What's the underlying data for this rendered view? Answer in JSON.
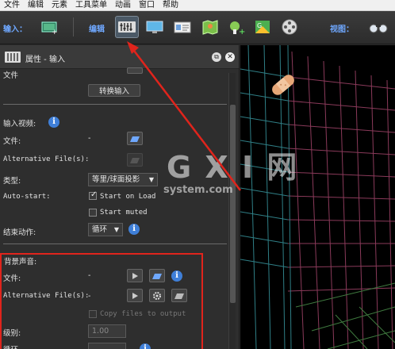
{
  "menu": {
    "items": [
      "文件",
      "编辑",
      "元素",
      "工具菜单",
      "动画",
      "窗口",
      "帮助"
    ]
  },
  "toolbar": {
    "input_label": "输入：",
    "edit_label": "编辑",
    "view_label": "视图："
  },
  "panel": {
    "title": "属性 - 输入",
    "top_label": "文件",
    "convert_button": "转换输入",
    "input_video_label": "输入视频:",
    "file_label": "文件:",
    "file_value": "-",
    "alt_files_label": "Alternative File(s):",
    "type_label": "类型:",
    "type_value": "等里/球面投影",
    "autostart_label": "Auto-start:",
    "start_on_load": "Start on Load",
    "start_muted": "Start muted",
    "end_action_label": "结束动作:",
    "end_action_value": "循环",
    "bg_sound_label": "背景声音:",
    "bg_file_label": "文件:",
    "bg_file_value": "-",
    "bg_alt_files_label": "Alternative File(s):",
    "bg_alt_files_value": "-",
    "copy_files_label": "Copy files to output",
    "level_label": "级别:",
    "level_value": "1.00",
    "bottom_label": "循环"
  },
  "watermark": {
    "big": "G X I 网",
    "small": "system.com"
  },
  "colors": {
    "annotation_red": "#e0241c",
    "info_blue": "#3f7fd8",
    "accent_blue": "#6fa8ff"
  }
}
